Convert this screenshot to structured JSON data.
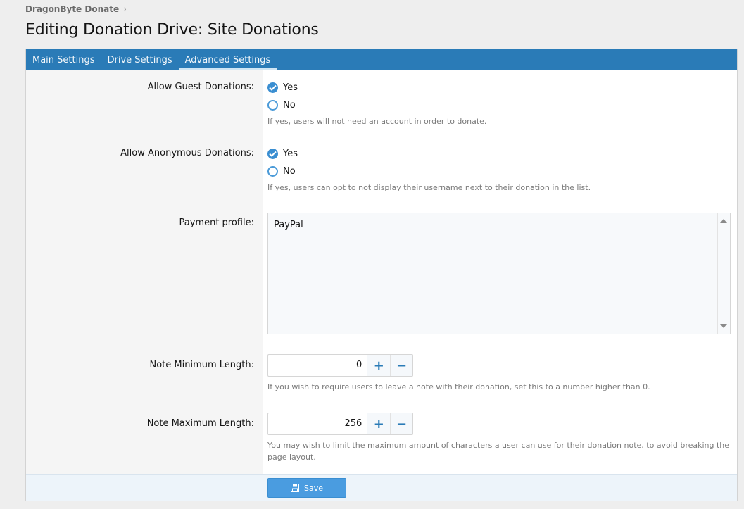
{
  "breadcrumb": {
    "item": "DragonByte Donate"
  },
  "page_title": "Editing Donation Drive: Site Donations",
  "tabs": [
    {
      "label": "Main Settings"
    },
    {
      "label": "Drive Settings"
    },
    {
      "label": "Advanced Settings"
    }
  ],
  "active_tab": "Advanced Settings",
  "form": {
    "guest": {
      "label": "Allow Guest Donations:",
      "yes": "Yes",
      "no": "No",
      "selected": "Yes",
      "hint": "If yes, users will not need an account in order to donate."
    },
    "anonymous": {
      "label": "Allow Anonymous Donations:",
      "yes": "Yes",
      "no": "No",
      "selected": "Yes",
      "hint": "If yes, users can opt to not display their username next to their donation in the list."
    },
    "payment": {
      "label": "Payment profile:",
      "options": [
        "PayPal"
      ]
    },
    "note_min": {
      "label": "Note Minimum Length:",
      "value": "0",
      "hint": "If you wish to require users to leave a note with their donation, set this to a number higher than 0."
    },
    "note_max": {
      "label": "Note Maximum Length:",
      "value": "256",
      "hint": "You may wish to limit the maximum amount of characters a user can use for their donation note, to avoid breaking the page layout."
    }
  },
  "save_label": "Save",
  "colors": {
    "accent": "#2a7bb7",
    "radio": "#3a8ed1",
    "save": "#4a9ce0"
  }
}
